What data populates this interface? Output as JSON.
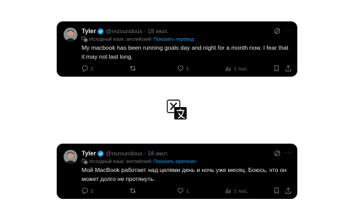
{
  "tweets": [
    {
      "author_name": "Tyler",
      "handle_time": "@rezoundous · 18 июл.",
      "translation_source": "Исходный язык: английский",
      "translation_link": "Показать перевод",
      "text": "My macbook has been running goals day and night for a month now. I fear that it may not last long.",
      "replies": "2",
      "likes": "1",
      "views": "1 тыс."
    },
    {
      "author_name": "Tyler",
      "handle_time": "@rezoundous · 18 июл.",
      "translation_source": "Исходный язык: английский",
      "translation_link": "Показать оригинал",
      "text": "Мой MacBook работает над целями день и ночь уже месяц. Боюсь, что он может долго не протянуть.",
      "replies": "2",
      "likes": "1",
      "views": "1 тыс."
    }
  ],
  "colors": {
    "card_background": "#000000",
    "primary_text": "#e7e9ea",
    "secondary_text": "#71767b",
    "link": "#1d9bf0",
    "verified_badge": "#1d9bf0"
  },
  "icons": [
    "avatar",
    "verified-badge-icon",
    "grok-icon",
    "more-icon",
    "translate-icon",
    "reply-icon",
    "retweet-icon",
    "like-icon",
    "views-icon",
    "bookmark-icon",
    "share-icon",
    "x-translate-logo-icon"
  ]
}
